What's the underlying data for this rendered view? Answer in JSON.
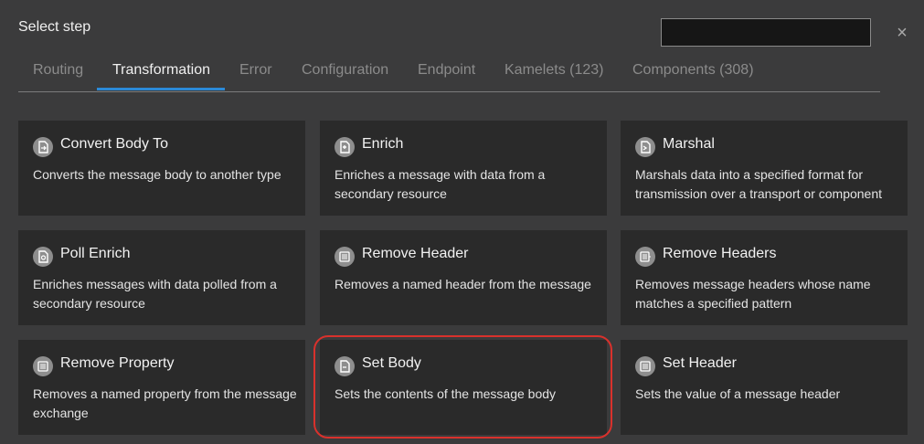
{
  "dialog": {
    "title": "Select step"
  },
  "search": {
    "value": ""
  },
  "close_label": "×",
  "tabs": [
    {
      "label": "Routing"
    },
    {
      "label": "Transformation",
      "active": true
    },
    {
      "label": "Error"
    },
    {
      "label": "Configuration"
    },
    {
      "label": "Endpoint"
    },
    {
      "label": "Kamelets (123)"
    },
    {
      "label": "Components (308)"
    }
  ],
  "cards": [
    {
      "name": "Convert Body To",
      "description": "Converts the message body to another type",
      "icon": "convert-body-icon"
    },
    {
      "name": "Enrich",
      "description": "Enriches a message with data from a secondary resource",
      "icon": "enrich-icon"
    },
    {
      "name": "Marshal",
      "description": "Marshals data into a specified format for transmission over a transport or component",
      "icon": "marshal-icon"
    },
    {
      "name": "Poll Enrich",
      "description": "Enriches messages with data polled from a secondary resource",
      "icon": "poll-enrich-icon"
    },
    {
      "name": "Remove Header",
      "description": "Removes a named header from the message",
      "icon": "remove-header-icon"
    },
    {
      "name": "Remove Headers",
      "description": "Removes message headers whose name matches a specified pattern",
      "icon": "remove-headers-icon"
    },
    {
      "name": "Remove Property",
      "description": "Removes a named property from the message exchange",
      "icon": "remove-property-icon"
    },
    {
      "name": "Set Body",
      "description": "Sets the contents of the message body",
      "icon": "set-body-icon"
    },
    {
      "name": "Set Header",
      "description": "Sets the value of a message header",
      "icon": "set-header-icon"
    }
  ],
  "colors": {
    "accent": "#2b8ad8",
    "highlight": "#d9312c",
    "card": "#2a2a2a",
    "background": "#3b3b3c"
  }
}
